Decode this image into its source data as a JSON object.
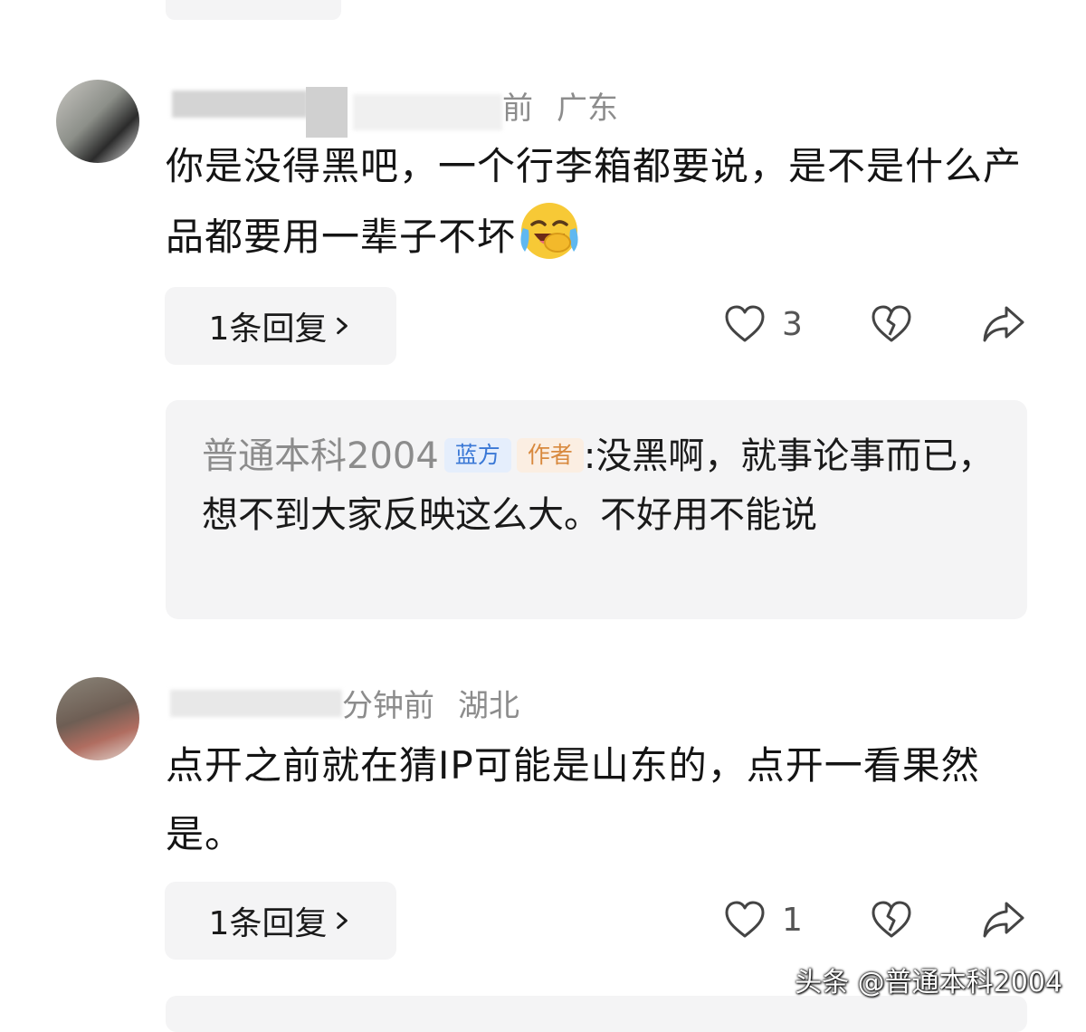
{
  "comments": [
    {
      "time_suffix": "前",
      "location": "广东",
      "text": "你是没得黑吧，一个行李箱都要说，是不是什么产品都要用一辈子不坏",
      "reply_button": "1条回复",
      "likes": "3"
    },
    {
      "time_suffix": "分钟前",
      "location": "湖北",
      "text": "点开之前就在猜IP可能是山东的，点开一看果然是。",
      "reply_button": "1条回复",
      "likes": "1"
    }
  ],
  "reply": {
    "author": "普通本科2004",
    "badge_blue": "蓝方",
    "badge_author": "作者",
    "text": "没黑啊，就事论事而已，想不到大家反映这么大。不好用不能说"
  },
  "watermark": "头条 @普通本科2004",
  "icons": [
    "heart-icon",
    "broken-heart-icon",
    "share-icon",
    "chevron-right-icon",
    "laughing-emoji"
  ]
}
